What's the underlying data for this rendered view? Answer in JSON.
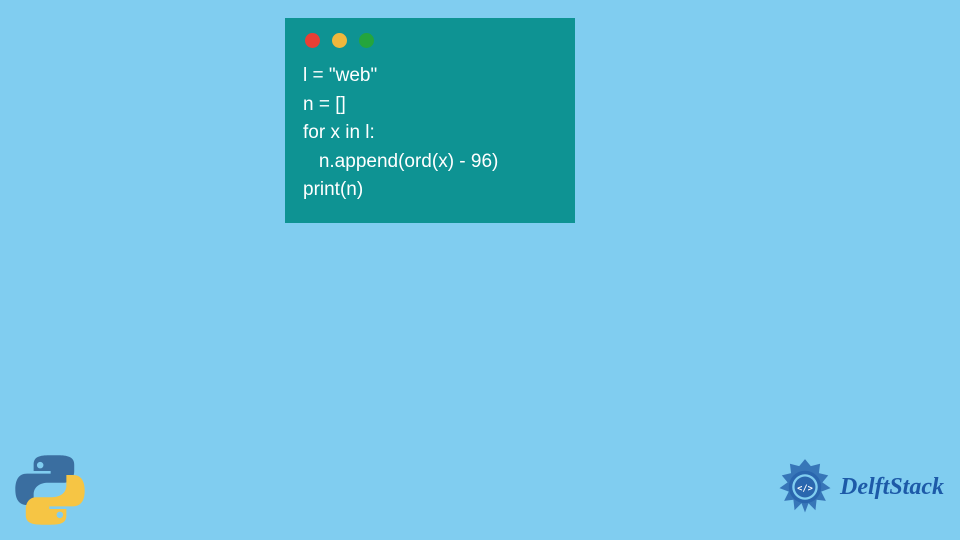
{
  "code": {
    "line1": "l = \"web\"",
    "line2": "n = []",
    "line3": "for x in l:",
    "line4": "   n.append(ord(x) - 96)",
    "line5": "print(n)"
  },
  "brand": {
    "name": "DelftStack"
  }
}
